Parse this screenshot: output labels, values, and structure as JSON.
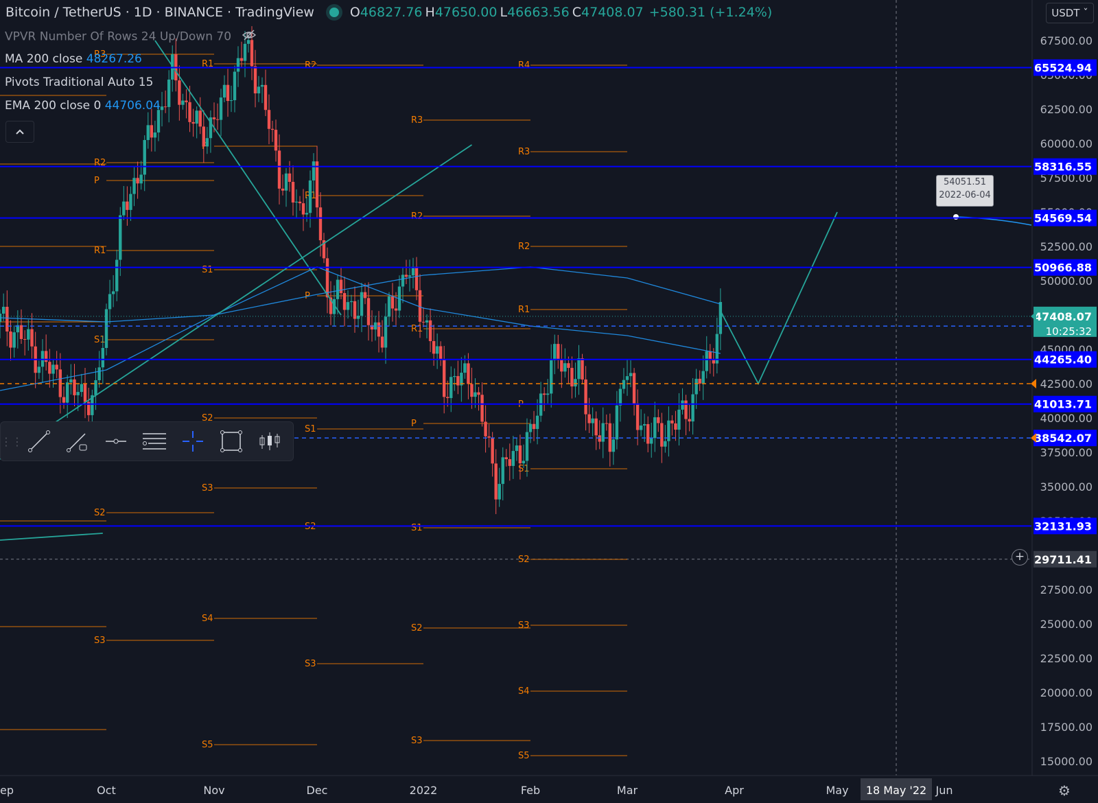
{
  "header": {
    "symbol": "Bitcoin / TetherUS · 1D · BINANCE · TradingView",
    "open_label": "O",
    "open": "46827.76",
    "high_label": "H",
    "high": "47650.00",
    "low_label": "L",
    "low": "46663.56",
    "close_label": "C",
    "close": "47408.07",
    "change": "+580.31 (+1.24%)"
  },
  "indicators": [
    {
      "name": "VPVR",
      "params": "Number Of Rows 24 Up/Down 70",
      "value": ""
    },
    {
      "name": "MA",
      "params": "200 close",
      "value": "48267.26"
    },
    {
      "name": "Pivots",
      "params": "Traditional Auto 15",
      "value": ""
    },
    {
      "name": "EMA",
      "params": "200 close 0",
      "value": "44706.04"
    }
  ],
  "currency_button": "USDT ˇ",
  "price_axis_ticks": [
    "67500.00",
    "65000.00",
    "62500.00",
    "60000.00",
    "57500.00",
    "55000.00",
    "52500.00",
    "50000.00",
    "47500.00",
    "45000.00",
    "42500.00",
    "40000.00",
    "37500.00",
    "35000.00",
    "32500.00",
    "30000.00",
    "27500.00",
    "25000.00",
    "22500.00",
    "20000.00",
    "17500.00",
    "15000.00"
  ],
  "time_axis_labels": [
    "ep",
    "Oct",
    "Nov",
    "Dec",
    "2022",
    "Feb",
    "Mar",
    "Apr",
    "May",
    "Jun"
  ],
  "time_axis_highlight": "18 May '22",
  "horizontal_levels": [
    {
      "value": "65524.94",
      "color": "#0000ff"
    },
    {
      "value": "58316.55",
      "color": "#0000ff"
    },
    {
      "value": "54569.54",
      "color": "#0000ff"
    },
    {
      "value": "50966.88",
      "color": "#0000ff"
    },
    {
      "value": "44265.40",
      "color": "#0000ff"
    },
    {
      "value": "41013.71",
      "color": "#0000ff"
    },
    {
      "value": "32131.93",
      "color": "#0000ff"
    }
  ],
  "dashed_levels": [
    {
      "value": "46692.55",
      "color": "#2962ff"
    },
    {
      "value": "42500.00",
      "color": "#f57c00"
    },
    {
      "value": "38542.07",
      "color": "#2962ff"
    }
  ],
  "last_price": {
    "value": "47408.07",
    "countdown": "10:25:32",
    "color": "#26a69a"
  },
  "crosshair_price": "29711.41",
  "tooltip": {
    "price": "54051.51",
    "date": "2022-06-04"
  },
  "colors": {
    "background": "#131722",
    "up": "#26a69a",
    "down": "#ef5350",
    "pivot": "#f57c00",
    "ma": "#2196f3",
    "level": "#0000ff"
  },
  "icons": [
    "eye-off-icon",
    "chevron-up-icon",
    "trend-line-icon",
    "ray-icon",
    "horizontal-ray-icon",
    "fib-icon",
    "crosshair-icon",
    "rectangle-icon",
    "candles-icon",
    "plus-icon",
    "gear-icon"
  ],
  "chart_data": {
    "type": "candlestick",
    "title": "Bitcoin / TetherUS · 1D · BINANCE",
    "ylim": [
      14000,
      69000
    ],
    "x_range": [
      "2021-09-01",
      "2022-06-30"
    ],
    "pivot_periods": [
      {
        "from": "2021-09-01",
        "to": "2021-10-01",
        "levels": {
          "R3": 63500,
          "R2": 58500,
          "R1": 52500,
          "P": 47000,
          "S2": 32500,
          "S3": 24800,
          "S4": 17300
        }
      },
      {
        "from": "2021-10-01",
        "to": "2021-11-01",
        "levels": {
          "R3": 66500,
          "R2": 58600,
          "R1": 52200,
          "P": 57300,
          "S1": 45700,
          "S2": 33100,
          "S3": 23800
        }
      },
      {
        "from": "2021-11-01",
        "to": "2021-12-01",
        "levels": {
          "R1": 65800,
          "P": 59800,
          "S1": 50800,
          "S2": 40000,
          "S3": 34900,
          "S4": 25400,
          "S5": 16200
        }
      },
      {
        "from": "2021-12-01",
        "to": "2022-01-01",
        "levels": {
          "R2": 65700,
          "R1": 56200,
          "P": 48900,
          "S1": 39200,
          "S2": 32100,
          "S3": 22100
        }
      },
      {
        "from": "2022-01-01",
        "to": "2022-02-01",
        "levels": {
          "R3": 61700,
          "R2": 54700,
          "R1": 46500,
          "P": 39600,
          "S1": 32000,
          "S2": 24700,
          "S3": 16500
        }
      },
      {
        "from": "2022-02-01",
        "to": "2022-03-01",
        "levels": {
          "R4": 65700,
          "R3": 59400,
          "R2": 52500,
          "R1": 47900,
          "P": 41000,
          "S1": 36300,
          "S2": 29700,
          "S3": 24900,
          "S4": 20100,
          "S5": 15400
        }
      }
    ],
    "lines": [
      {
        "name": "trend-down",
        "points": [
          [
            "2021-10-15",
            67500
          ],
          [
            "2021-12-08",
            47500
          ]
        ]
      },
      {
        "name": "trend-up",
        "points": [
          [
            "2021-09-01",
            37000
          ],
          [
            "2022-01-15",
            59900
          ]
        ]
      },
      {
        "name": "projection",
        "points": [
          [
            "2022-03-28",
            47800
          ],
          [
            "2022-04-08",
            42500
          ],
          [
            "2022-05-01",
            55000
          ]
        ]
      },
      {
        "name": "support-low",
        "points": [
          [
            "2021-09-01",
            31100
          ],
          [
            "2021-09-30",
            31600
          ]
        ]
      }
    ]
  }
}
